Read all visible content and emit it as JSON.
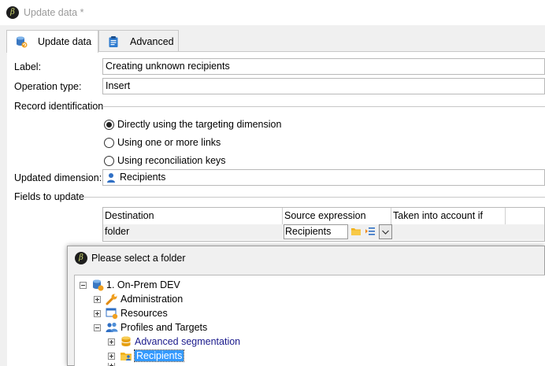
{
  "window": {
    "title": "Update data *"
  },
  "tabs": [
    {
      "label": "Update data",
      "icon": "database-refresh-icon",
      "active": true
    },
    {
      "label": "Advanced",
      "icon": "clipboard-icon",
      "active": false
    }
  ],
  "form": {
    "label_caption": "Label:",
    "label_value": "Creating unknown recipients",
    "operation_caption": "Operation type:",
    "operation_value": "Insert",
    "record_id_caption": "Record identification",
    "radios": [
      {
        "label": "Directly using the targeting dimension",
        "checked": true
      },
      {
        "label": "Using one or more links",
        "checked": false
      },
      {
        "label": "Using reconciliation keys",
        "checked": false
      }
    ],
    "dimension_caption": "Updated dimension:",
    "dimension_value": "Recipients",
    "fields_caption": "Fields to update"
  },
  "grid": {
    "headers": [
      "Destination",
      "Source expression",
      "Taken into account if"
    ],
    "row": {
      "destination": "folder",
      "source": "Recipients"
    }
  },
  "dialog": {
    "title": "Please select a folder",
    "tree": [
      {
        "label": "1. On-Prem DEV",
        "level": 0,
        "expander": "minus",
        "icon": "database-icon"
      },
      {
        "label": "Administration",
        "level": 1,
        "expander": "plus",
        "icon": "wrench-icon"
      },
      {
        "label": "Resources",
        "level": 1,
        "expander": "plus",
        "icon": "window-gear-icon"
      },
      {
        "label": "Profiles and Targets",
        "level": 1,
        "expander": "minus",
        "icon": "people-icon"
      },
      {
        "label": "Advanced segmentation",
        "level": 2,
        "expander": "plus",
        "icon": "database-stack-icon"
      },
      {
        "label": "Recipients",
        "level": 2,
        "expander": "plus",
        "icon": "folder-person-icon",
        "selected": true
      }
    ]
  }
}
